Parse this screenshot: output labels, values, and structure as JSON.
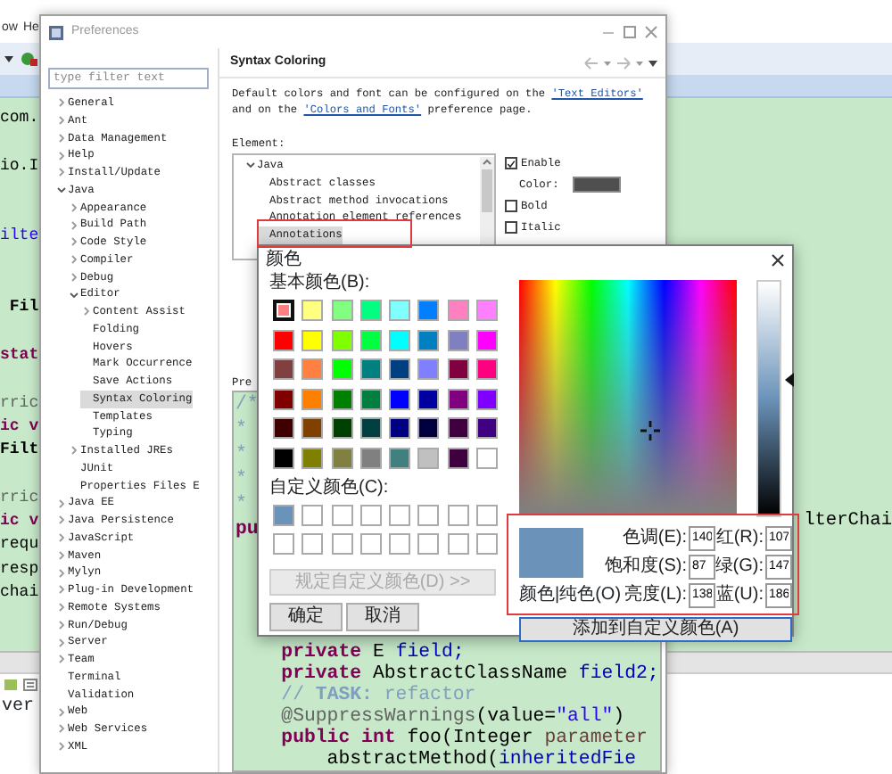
{
  "ide": {
    "menu": [
      {
        "label": "ow"
      },
      {
        "label": "He"
      }
    ],
    "editor_rows": [
      {
        "left": {
          "text": "com.",
          "kind": "plain"
        }
      },
      {},
      {
        "left": {
          "text": "io.I",
          "kind": "plain"
        }
      },
      {},
      {},
      {
        "left": {
          "text": "ilte",
          "kind": "string"
        }
      },
      {},
      {},
      {
        "left": {
          "text": " Fil",
          "kind": "bold"
        }
      },
      {},
      {
        "left": {
          "text": "stat",
          "kind": "keyword"
        }
      },
      {},
      {
        "left": {
          "text": "rric",
          "kind": "annotation"
        }
      },
      {
        "left": {
          "text": "ic v",
          "kind": "keyword"
        }
      },
      {
        "left": {
          "text": "Filt",
          "kind": "bold"
        }
      },
      {},
      {
        "left": {
          "text": "rric",
          "kind": "annotation"
        }
      },
      {
        "left": {
          "text": "ic v",
          "kind": "keyword"
        },
        "right": {
          "text": "lterChai",
          "kind": "plain"
        }
      },
      {
        "left": {
          "text": "requ",
          "kind": "plain"
        }
      },
      {
        "left": {
          "text": "resp",
          "kind": "plain"
        }
      },
      {
        "left": {
          "text": "chai",
          "kind": "plain"
        }
      }
    ],
    "console_text": "ver"
  },
  "preferences": {
    "title": "Preferences",
    "filter_placeholder": "type filter text",
    "tree": [
      {
        "label": "General",
        "expanded": false,
        "selected": false
      },
      {
        "label": "Ant",
        "expanded": false,
        "selected": false
      },
      {
        "label": "Data Management",
        "expanded": false,
        "selected": false
      },
      {
        "label": "Help",
        "expanded": false,
        "selected": false
      },
      {
        "label": "Install/Update",
        "expanded": false,
        "selected": false
      },
      {
        "label": "Java",
        "expanded": true,
        "selected": false,
        "children": [
          {
            "label": "Appearance",
            "expanded": false,
            "selected": false
          },
          {
            "label": "Build Path",
            "expanded": false,
            "selected": false
          },
          {
            "label": "Code Style",
            "expanded": false,
            "selected": false
          },
          {
            "label": "Compiler",
            "expanded": false,
            "selected": false
          },
          {
            "label": "Debug",
            "expanded": false,
            "selected": false
          },
          {
            "label": "Editor",
            "expanded": true,
            "selected": false,
            "children": [
              {
                "label": "Content Assist",
                "expanded": false,
                "selected": false
              },
              {
                "label": "Folding",
                "selected": false
              },
              {
                "label": "Hovers",
                "selected": false
              },
              {
                "label": "Mark Occurrence",
                "selected": false
              },
              {
                "label": "Save Actions",
                "selected": false
              },
              {
                "label": "Syntax Coloring",
                "selected": true
              },
              {
                "label": "Templates",
                "selected": false
              },
              {
                "label": "Typing",
                "selected": false
              }
            ]
          },
          {
            "label": "Installed JREs",
            "expanded": false,
            "selected": false
          },
          {
            "label": "JUnit",
            "selected": false
          },
          {
            "label": "Properties Files E",
            "selected": false
          }
        ]
      },
      {
        "label": "Java EE",
        "expanded": false,
        "selected": false
      },
      {
        "label": "Java Persistence",
        "expanded": false,
        "selected": false
      },
      {
        "label": "JavaScript",
        "expanded": false,
        "selected": false
      },
      {
        "label": "Maven",
        "expanded": false,
        "selected": false
      },
      {
        "label": "Mylyn",
        "expanded": false,
        "selected": false
      },
      {
        "label": "Plug-in Development",
        "expanded": false,
        "selected": false
      },
      {
        "label": "Remote Systems",
        "expanded": false,
        "selected": false
      },
      {
        "label": "Run/Debug",
        "expanded": false,
        "selected": false
      },
      {
        "label": "Server",
        "expanded": false,
        "selected": false
      },
      {
        "label": "Team",
        "expanded": false,
        "selected": false
      },
      {
        "label": "Terminal",
        "selected": false
      },
      {
        "label": "Validation",
        "selected": false
      },
      {
        "label": "Web",
        "expanded": false,
        "selected": false
      },
      {
        "label": "Web Services",
        "expanded": false,
        "selected": false
      },
      {
        "label": "XML",
        "expanded": false,
        "selected": false
      }
    ],
    "page_title": "Syntax Coloring",
    "description": [
      {
        "kind": "text",
        "text": "Default colors and font can be configured on the "
      },
      {
        "kind": "link",
        "text": "'Text Editors'"
      },
      {
        "kind": "text",
        "text": " and on the "
      },
      {
        "kind": "link",
        "text": "'Colors and Fonts'"
      },
      {
        "kind": "text",
        "text": " preference page."
      }
    ],
    "element_label": "Element:",
    "elements": [
      {
        "label": "Java",
        "expanded": true,
        "selected": false,
        "children": [
          {
            "label": "Abstract classes",
            "selected": false
          },
          {
            "label": "Abstract method invocations",
            "selected": false
          },
          {
            "label": "Annotation element references",
            "selected": false
          },
          {
            "label": "Annotations",
            "selected": true
          }
        ]
      }
    ],
    "options": [
      {
        "kind": "checkbox",
        "label": "Enable",
        "checked": true
      },
      {
        "kind": "color",
        "label": "Color:",
        "color": "#4f4f4f"
      },
      {
        "kind": "checkbox",
        "label": "Bold",
        "checked": false
      },
      {
        "kind": "checkbox",
        "label": "Italic",
        "checked": false
      }
    ],
    "preview_label": "Pre",
    "preview_top": [
      [
        {
          "text": "/*",
          "kind": "comment"
        }
      ],
      [
        {
          "text": "*",
          "kind": "comment"
        }
      ],
      [
        {
          "text": "*",
          "kind": "comment"
        }
      ],
      [
        {
          "text": "*",
          "kind": "comment"
        }
      ],
      [
        {
          "text": "*",
          "kind": "comment"
        }
      ],
      [
        {
          "text": "pu",
          "kind": "keyword"
        }
      ]
    ],
    "preview_bottom": [
      [
        {
          "text": "    private",
          "kind": "keyword"
        },
        {
          "text": " E ",
          "kind": "plain"
        },
        {
          "text": "field;",
          "kind": "field"
        }
      ],
      [
        {
          "text": "    private",
          "kind": "keyword"
        },
        {
          "text": " AbstractClassName ",
          "kind": "plain"
        },
        {
          "text": "field2;",
          "kind": "field"
        }
      ],
      [
        {
          "text": "    // ",
          "kind": "comment"
        },
        {
          "text": "TASK:",
          "kind": "task"
        },
        {
          "text": " refactor",
          "kind": "comment"
        }
      ],
      [
        {
          "text": "    @SuppressWarnings",
          "kind": "annotation"
        },
        {
          "text": "(value=",
          "kind": "plain"
        },
        {
          "text": "\"all\"",
          "kind": "string"
        },
        {
          "text": ")",
          "kind": "plain"
        }
      ],
      [
        {
          "text": "    public int",
          "kind": "keyword"
        },
        {
          "text": " foo(Integer ",
          "kind": "plain"
        },
        {
          "text": "parameter",
          "kind": "param"
        }
      ],
      [
        {
          "text": "        abstractMethod(",
          "kind": "plain"
        },
        {
          "text": "inheritedFie",
          "kind": "field"
        }
      ]
    ]
  },
  "color_dialog": {
    "title": "颜色",
    "basic_label": "基本颜色(B):",
    "basic_colors": [
      {
        "color": "#ff8080",
        "selected": true
      },
      {
        "color": "#ffff80",
        "selected": false
      },
      {
        "color": "#80ff80",
        "selected": false
      },
      {
        "color": "#00ff80",
        "selected": false
      },
      {
        "color": "#80ffff",
        "selected": false
      },
      {
        "color": "#0080ff",
        "selected": false
      },
      {
        "color": "#ff80c0",
        "selected": false
      },
      {
        "color": "#ff80ff",
        "selected": false
      },
      {
        "color": "#ff0000",
        "selected": false
      },
      {
        "color": "#ffff00",
        "selected": false
      },
      {
        "color": "#80ff00",
        "selected": false
      },
      {
        "color": "#00ff40",
        "selected": false
      },
      {
        "color": "#00ffff",
        "selected": false
      },
      {
        "color": "#0080c0",
        "selected": false
      },
      {
        "color": "#8080c0",
        "selected": false
      },
      {
        "color": "#ff00ff",
        "selected": false
      },
      {
        "color": "#804040",
        "selected": false
      },
      {
        "color": "#ff8040",
        "selected": false
      },
      {
        "color": "#00ff00",
        "selected": false
      },
      {
        "color": "#008080",
        "selected": false
      },
      {
        "color": "#004080",
        "selected": false
      },
      {
        "color": "#8080ff",
        "selected": false
      },
      {
        "color": "#800040",
        "selected": false
      },
      {
        "color": "#ff0080",
        "selected": false
      },
      {
        "color": "#800000",
        "selected": false
      },
      {
        "color": "#ff8000",
        "selected": false
      },
      {
        "color": "#008000",
        "selected": false
      },
      {
        "color": "#008040",
        "selected": false
      },
      {
        "color": "#0000ff",
        "selected": false
      },
      {
        "color": "#0000a0",
        "selected": false
      },
      {
        "color": "#800080",
        "selected": false
      },
      {
        "color": "#8000ff",
        "selected": false
      },
      {
        "color": "#400000",
        "selected": false
      },
      {
        "color": "#804000",
        "selected": false
      },
      {
        "color": "#004000",
        "selected": false
      },
      {
        "color": "#004040",
        "selected": false
      },
      {
        "color": "#000080",
        "selected": false
      },
      {
        "color": "#000040",
        "selected": false
      },
      {
        "color": "#400040",
        "selected": false
      },
      {
        "color": "#400080",
        "selected": false
      },
      {
        "color": "#000000",
        "selected": false
      },
      {
        "color": "#808000",
        "selected": false
      },
      {
        "color": "#808040",
        "selected": false
      },
      {
        "color": "#808080",
        "selected": false
      },
      {
        "color": "#408080",
        "selected": false
      },
      {
        "color": "#c0c0c0",
        "selected": false
      },
      {
        "color": "#400040",
        "selected": false
      },
      {
        "color": "#ffffff",
        "selected": false
      }
    ],
    "custom_label": "自定义颜色(C):",
    "custom_colors": [
      {
        "color": "#6b93ba"
      },
      {
        "color": "#ffffff"
      },
      {
        "color": "#ffffff"
      },
      {
        "color": "#ffffff"
      },
      {
        "color": "#ffffff"
      },
      {
        "color": "#ffffff"
      },
      {
        "color": "#ffffff"
      },
      {
        "color": "#ffffff"
      },
      {
        "color": "#ffffff"
      },
      {
        "color": "#ffffff"
      },
      {
        "color": "#ffffff"
      },
      {
        "color": "#ffffff"
      },
      {
        "color": "#ffffff"
      },
      {
        "color": "#ffffff"
      },
      {
        "color": "#ffffff"
      },
      {
        "color": "#ffffff"
      }
    ],
    "define_button": {
      "label": "规定自定义颜色(D) >>",
      "disabled": true
    },
    "ok_button": {
      "label": "确定"
    },
    "cancel_button": {
      "label": "取消"
    },
    "preview": {
      "color": "#6b93ba",
      "label": "颜色|纯色(O)"
    },
    "fields": [
      {
        "label": "色调(E):",
        "value": "140"
      },
      {
        "label": "红(R):",
        "value": "107"
      },
      {
        "label": "饱和度(S):",
        "value": "87"
      },
      {
        "label": "绿(G):",
        "value": "147"
      },
      {
        "label": "亮度(L):",
        "value": "138"
      },
      {
        "label": "蓝(U):",
        "value": "186"
      }
    ],
    "add_button": {
      "label": "添加到自定义颜色(A)",
      "focused": true
    }
  }
}
